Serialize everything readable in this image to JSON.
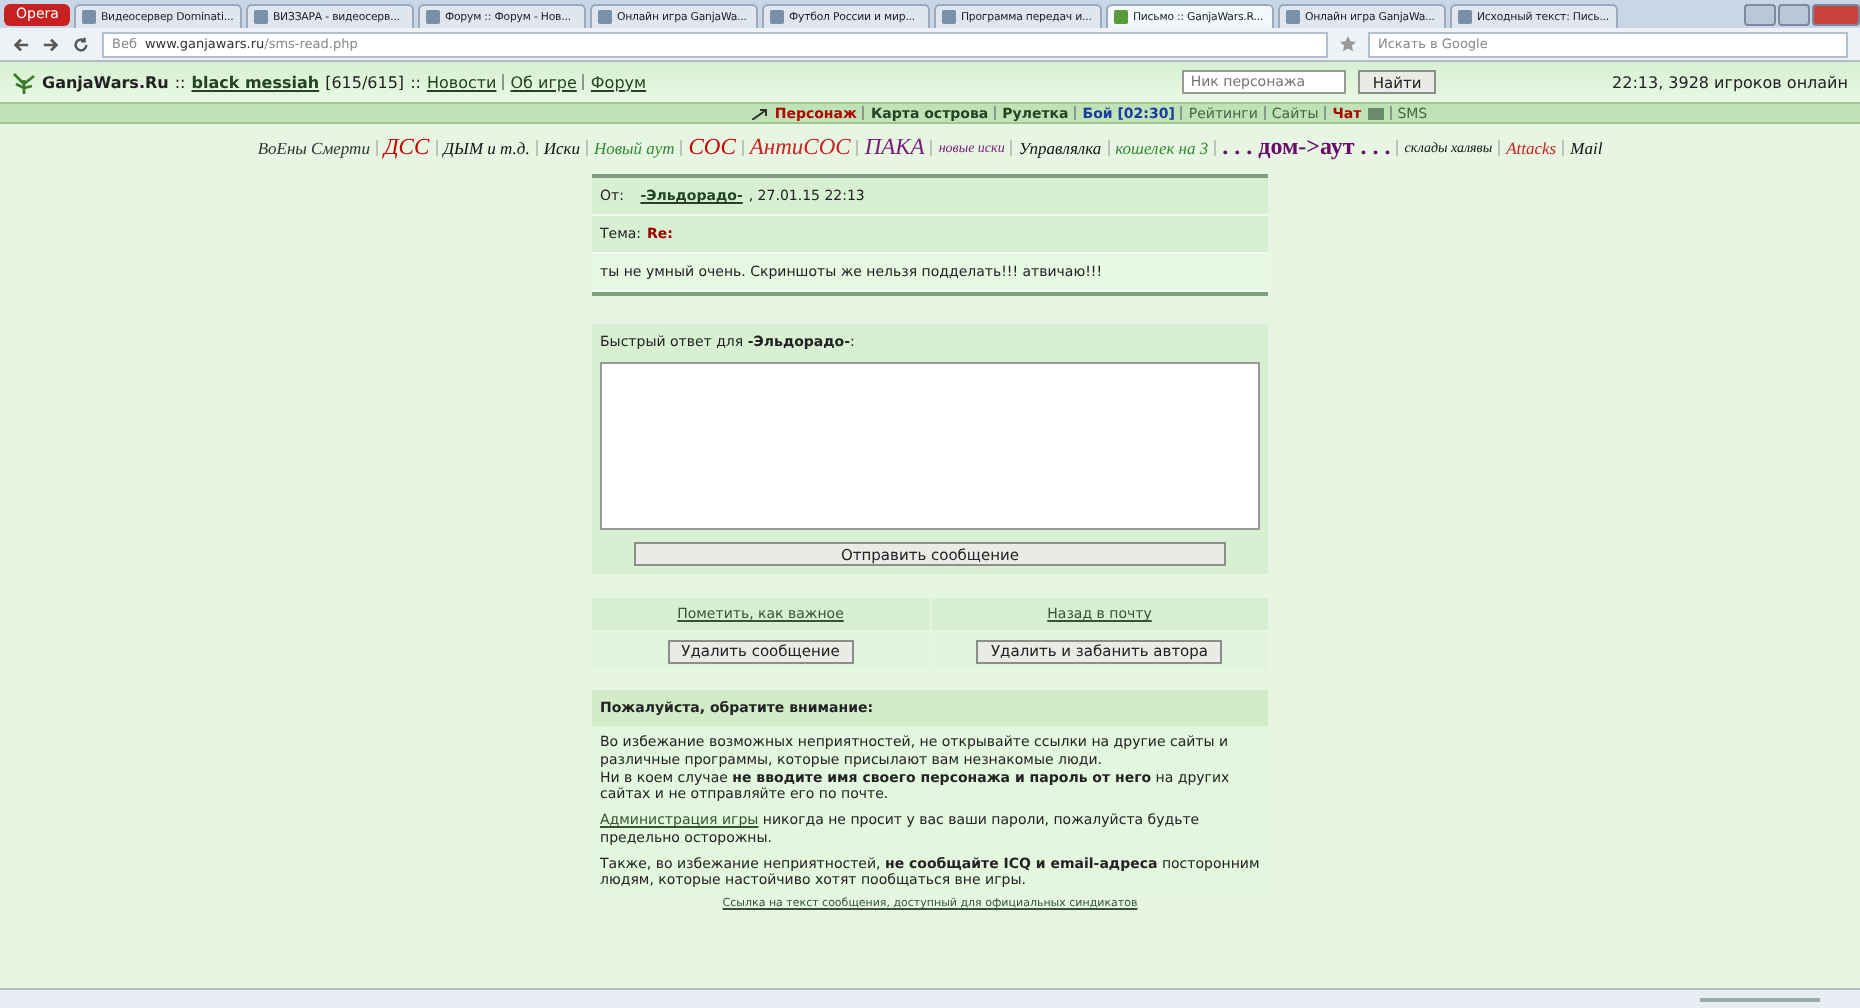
{
  "browser": {
    "menu": "Opera",
    "tabs": [
      {
        "title": "Видеосервер Dominati...",
        "selected": false
      },
      {
        "title": "ВИЗЗАРА - видеосерв...",
        "selected": false
      },
      {
        "title": "Форум :: Форум - Нов...",
        "selected": false
      },
      {
        "title": "Онлайн игра GanjaWa...",
        "selected": false
      },
      {
        "title": "Футбол России и мир...",
        "selected": false
      },
      {
        "title": "Программа передач и...",
        "selected": false
      },
      {
        "title": "Письмо :: GanjaWars.R...",
        "selected": true
      },
      {
        "title": "Онлайн игра GanjaWa...",
        "selected": false
      },
      {
        "title": "Исходный текст: Пись...",
        "selected": false
      }
    ],
    "web_label": "Веб",
    "address_host": "www.ganjawars.ru",
    "address_path": "/sms-read.php",
    "search_placeholder": "Искать в Google"
  },
  "header": {
    "site": "GanjaWars.Ru",
    "separator": "::",
    "user": "black messiah",
    "hp": "[615/615]",
    "separator_2": "::",
    "links": [
      "Новости",
      "Об игре",
      "Форум"
    ],
    "search_placeholder": "Ник персонажа",
    "search_button": "Найти",
    "online": "22:13, 3928 игроков онлайн"
  },
  "nav": [
    {
      "label": "Персонаж",
      "kind": "red"
    },
    {
      "label": "Карта острова",
      "kind": "bold"
    },
    {
      "label": "Рулетка",
      "kind": "bold"
    },
    {
      "label": "Бой [02:30]",
      "kind": "blue"
    },
    {
      "label": "Рейтинги",
      "kind": "plain"
    },
    {
      "label": "Сайты",
      "kind": "plain"
    },
    {
      "label": "Чат",
      "kind": "chat"
    },
    {
      "label": "SMS",
      "kind": "plain"
    }
  ],
  "clan_links": [
    {
      "label": "ВоЕны Смерти",
      "color": "#333333",
      "kind": "normal"
    },
    {
      "label": "ДСС",
      "color": "#cc0000",
      "kind": "large"
    },
    {
      "label": "ДЫМ и т.д.",
      "color": "#111111",
      "kind": "normal"
    },
    {
      "label": "Иски",
      "color": "#111111",
      "kind": "normal"
    },
    {
      "label": "Новый аут",
      "color": "#338833",
      "kind": "normal"
    },
    {
      "label": "СОС",
      "color": "#cc0000",
      "kind": "large"
    },
    {
      "label": "АнтиСОС",
      "color": "#cc2222",
      "kind": "large"
    },
    {
      "label": "ПАКА",
      "color": "#7a1a7a",
      "kind": "large"
    },
    {
      "label": "новые иски",
      "color": "#7a1a7a",
      "kind": "small"
    },
    {
      "label": "Управлялка",
      "color": "#111111",
      "kind": "normal"
    },
    {
      "label": "кошелек на 3",
      "color": "#338833",
      "kind": "normal"
    },
    {
      "label": ". . . дом->аут . . .",
      "color": "#6a0a6a",
      "kind": "huge"
    },
    {
      "label": "склады халявы",
      "color": "#111111",
      "kind": "small"
    },
    {
      "label": "Attacks",
      "color": "#cc2222",
      "kind": "normal"
    },
    {
      "label": "Mail",
      "color": "#111111",
      "kind": "normal"
    }
  ],
  "message": {
    "from_label": "От:",
    "sender": "-Эльдорадо-",
    "date": ", 27.01.15 22:13",
    "subject_label": "Тема:",
    "subject": "Re:",
    "body": "ты не умный очень. Скриншоты же нельзя подделать!!! атвичаю!!!"
  },
  "reply": {
    "title": "Быстрый ответ для **-Эльдорадо-**:",
    "send_button": "Отправить сообщение"
  },
  "actions": {
    "links": [
      "Пометить, как важное",
      "Назад в почту"
    ],
    "buttons": [
      "Удалить сообщение",
      "Удалить и забанить автора"
    ]
  },
  "notice": {
    "title": "Пожалуйста, обратите внимание:",
    "paragraph_1": "Во избежание возможных неприятностей, не открывайте ссылки на другие сайты и различные программы, которые присылают вам незнакомые люди.",
    "paragraph_2": "Ни в коем случае **не вводите имя своего персонажа и пароль от него** на других сайтах и не отправляйте его по почте.",
    "admin_link": "Администрация игры",
    "paragraph_3": " никогда не просит у вас ваши пароли, пожалуйста будьте предельно осторожны.",
    "paragraph_4": "Также, во избежание неприятностей, **не сообщайте ICQ и email-адреса** посторонним людям, которые настойчиво хотят пообщаться вне игры."
  },
  "footer_link": "Ссылка на текст сообщения, доступный для официальных синдикатов"
}
